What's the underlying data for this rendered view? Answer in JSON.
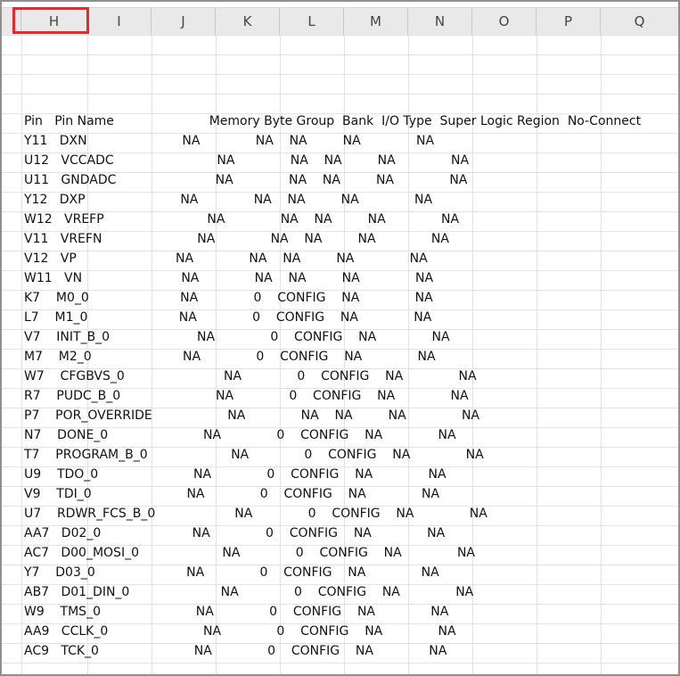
{
  "sheet": {
    "columns": [
      "H",
      "I",
      "J",
      "K",
      "L",
      "M",
      "N",
      "O",
      "P",
      "Q"
    ],
    "header_row": "Pin   Pin Name                        Memory Byte Group  Bank  I/O Type  Super Logic Region  No-Connect",
    "rows": [
      "Y11   DXN                        NA              NA    NA         NA              NA",
      "U12   VCCADC                          NA              NA    NA         NA              NA",
      "U11   GNDADC                         NA              NA    NA         NA              NA",
      "Y12   DXP                        NA              NA    NA         NA              NA",
      "W12   VREFP                          NA              NA    NA         NA              NA",
      "V11   VREFN                        NA              NA    NA         NA              NA",
      "V12   VP                         NA              NA    NA         NA              NA",
      "W11   VN                         NA              NA    NA         NA              NA",
      "K7    M0_0                       NA              0    CONFIG    NA              NA",
      "L7    M1_0                       NA              0    CONFIG    NA              NA",
      "V7    INIT_B_0                      NA              0    CONFIG    NA              NA",
      "M7    M2_0                       NA              0    CONFIG    NA              NA",
      "W7    CFGBVS_0                         NA              0    CONFIG    NA              NA",
      "R7    PUDC_B_0                        NA              0    CONFIG    NA              NA",
      "P7    POR_OVERRIDE                   NA              NA    NA         NA              NA",
      "N7    DONE_0                        NA              0    CONFIG    NA              NA",
      "T7    PROGRAM_B_0                     NA              0    CONFIG    NA              NA",
      "U9    TDO_0                        NA              0    CONFIG    NA              NA",
      "V9    TDI_0                        NA              0    CONFIG    NA              NA",
      "U7    RDWR_FCS_B_0                    NA              0    CONFIG    NA              NA",
      "AA7   D02_0                       NA              0    CONFIG    NA              NA",
      "AC7   D00_MOSI_0                     NA              0    CONFIG    NA              NA",
      "Y7    D03_0                       NA              0    CONFIG    NA              NA",
      "AB7   D01_DIN_0                       NA              0    CONFIG    NA              NA",
      "W9    TMS_0                        NA              0    CONFIG    NA              NA",
      "AA9   CCLK_0                        NA              0    CONFIG    NA              NA",
      "AC9   TCK_0                        NA              0    CONFIG    NA              NA"
    ]
  },
  "selection": {
    "column": "H",
    "highlight_color": "#e8262b"
  },
  "colors": {
    "header_bg": "#e9e9e9",
    "grid_line": "#e2e2e2",
    "frame": "#8f8f8f"
  }
}
